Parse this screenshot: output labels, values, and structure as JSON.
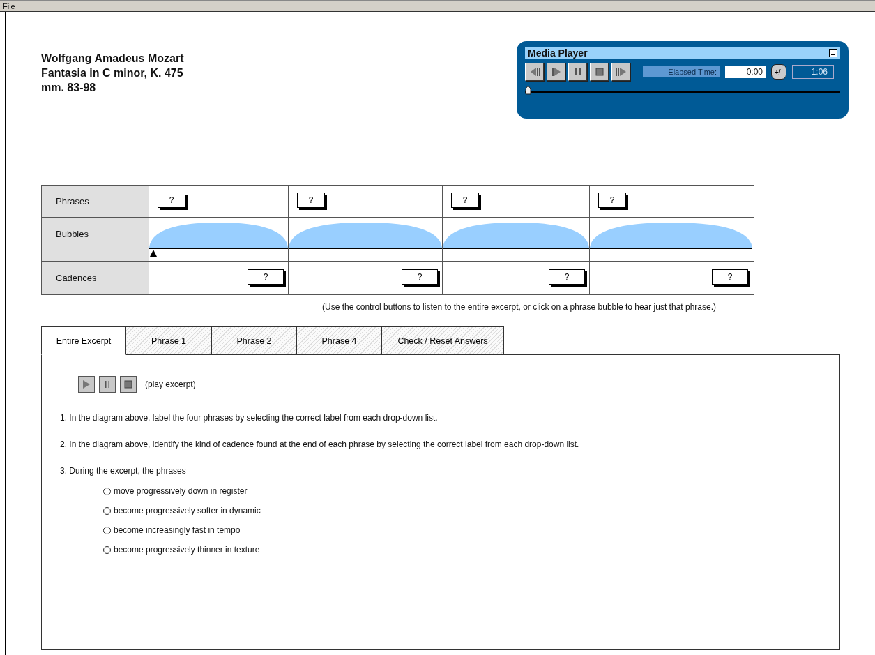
{
  "menu": [
    {
      "label": "File"
    }
  ],
  "header": {
    "lines": [
      "Wolfgang Amadeus Mozart",
      "Fantasia in C minor, K. 475",
      "mm. 83-98"
    ]
  },
  "media_player": {
    "title": "Media Player",
    "elapsed_label": "Elapsed Time:",
    "elapsed": "0:00",
    "toggle": "+/-",
    "duration": "1:06",
    "seek": {
      "level": 0
    }
  },
  "diagram": {
    "row_labels": [
      "Phrases",
      "Bubbles",
      "Cadences"
    ],
    "phrases": [
      {
        "value": "?"
      },
      {
        "value": "?"
      },
      {
        "value": "?"
      },
      {
        "value": "?"
      }
    ],
    "cadences": [
      {
        "value": "?"
      },
      {
        "value": "?"
      },
      {
        "value": "?"
      },
      {
        "value": "?"
      }
    ],
    "caption": "(Use the control buttons to listen to the entire excerpt, or click on a phrase bubble to hear just that phrase.)"
  },
  "tabs": [
    {
      "label": "Entire Excerpt",
      "selected": true
    },
    {
      "label": "Phrase 1",
      "selected": false
    },
    {
      "label": "Phrase 2",
      "selected": false
    },
    {
      "label": "Phrase 4",
      "selected": false
    },
    {
      "label": "Check / Reset Answers",
      "selected": false
    }
  ],
  "panel": {
    "play_label": "(play excerpt)",
    "questions": [
      {
        "text": "1. In the diagram above, label the four phrases by selecting the correct label from each drop-down list."
      },
      {
        "text": "2. In the diagram above, identify the kind of cadence found at the end of each phrase by selecting the correct label from each drop-down list."
      },
      {
        "text": "3. During the excerpt, the phrases",
        "options": [
          {
            "label": "move progressively down in register",
            "selected": false
          },
          {
            "label": "become progressively softer in dynamic",
            "selected": false
          },
          {
            "label": "become increasingly fast in tempo",
            "selected": false
          },
          {
            "label": "become progressively thinner in texture",
            "selected": false
          }
        ]
      }
    ]
  }
}
